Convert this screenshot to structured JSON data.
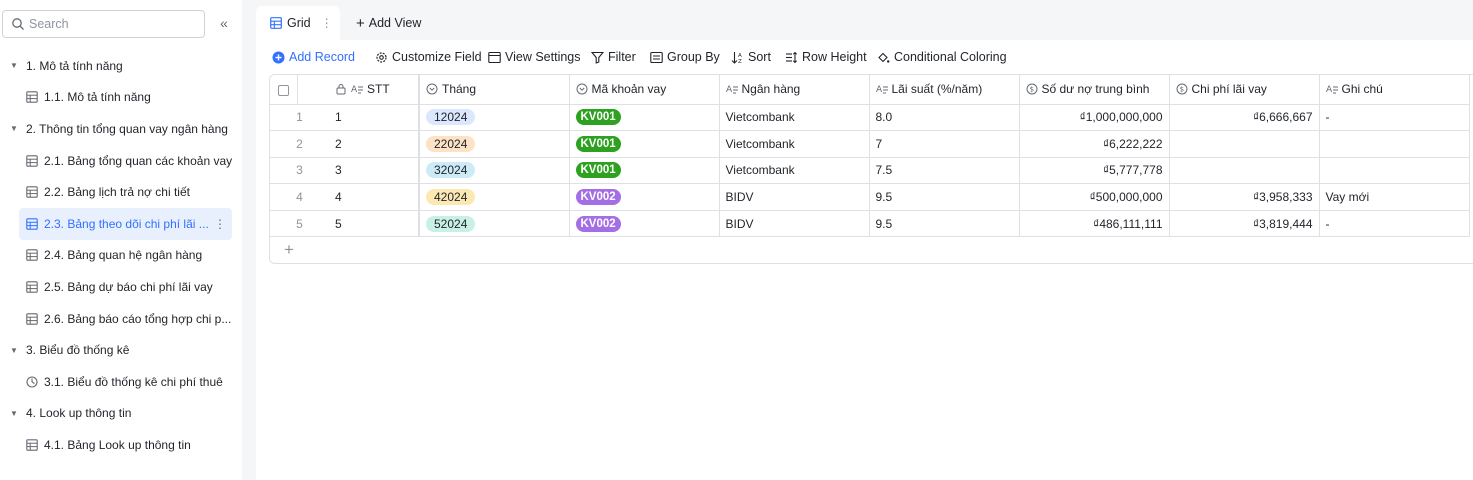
{
  "sidebar": {
    "search_placeholder": "Search",
    "items": [
      {
        "type": "group",
        "label": "1. Mô tả tính năng"
      },
      {
        "type": "leaf",
        "label": "1.1. Mô tả tính năng",
        "icon": "table-icon"
      },
      {
        "type": "group",
        "label": "2. Thông tin tổng quan vay ngân hàng"
      },
      {
        "type": "leaf",
        "label": "2.1. Bảng tổng quan các khoản vay",
        "icon": "table-icon"
      },
      {
        "type": "leaf",
        "label": "2.2. Bảng lịch trả nợ chi tiết",
        "icon": "table-icon"
      },
      {
        "type": "leaf",
        "label": "2.3. Bảng theo dõi chi phí lãi ...",
        "icon": "table-icon",
        "active": true
      },
      {
        "type": "leaf",
        "label": "2.4. Bảng quan hệ ngân hàng",
        "icon": "table-icon"
      },
      {
        "type": "leaf",
        "label": "2.5. Bảng dự báo chi phí lãi vay",
        "icon": "table-icon"
      },
      {
        "type": "leaf",
        "label": "2.6. Bảng báo cáo tổng hợp chi p...",
        "icon": "table-icon"
      },
      {
        "type": "group",
        "label": "3. Biểu đồ thống kê"
      },
      {
        "type": "leaf",
        "label": "3.1. Biểu đồ thống kê chi phí thuê",
        "icon": "dashboard-icon"
      },
      {
        "type": "group",
        "label": "4. Look up thông tin"
      },
      {
        "type": "leaf",
        "label": "4.1. Bảng Look up thông tin",
        "icon": "table-icon"
      }
    ]
  },
  "tabs": {
    "grid_label": "Grid",
    "add_view_label": "Add View"
  },
  "toolbar": {
    "add_record": "Add Record",
    "customize_field": "Customize Field",
    "view_settings": "View Settings",
    "filter": "Filter",
    "group_by": "Group By",
    "sort": "Sort",
    "row_height": "Row Height",
    "conditional_coloring": "Conditional Coloring"
  },
  "table": {
    "columns": [
      "STT",
      "Tháng",
      "Mã khoản vay",
      "Ngân hàng",
      "Lãi suất (%/năm)",
      "Số dư nợ trung bình",
      "Chi phí lãi vay",
      "Ghi chú"
    ],
    "rows": [
      {
        "idx": "1",
        "stt": "1",
        "thang": "12024",
        "thang_color": "#dbe7fd",
        "ma": "KV001",
        "ma_color": "#2ea121",
        "ngan_hang": "Vietcombank",
        "lai_suat": "8.0",
        "so_du": "₫1,000,000,000",
        "chi_phi": "₫6,666,667",
        "ghi_chu": "-"
      },
      {
        "idx": "2",
        "stt": "2",
        "thang": "22024",
        "thang_color": "#fde2c6",
        "ma": "KV001",
        "ma_color": "#2ea121",
        "ngan_hang": "Vietcombank",
        "lai_suat": "7",
        "so_du": "₫6,222,222",
        "chi_phi": "",
        "ghi_chu": ""
      },
      {
        "idx": "3",
        "stt": "3",
        "thang": "32024",
        "thang_color": "#cdebf6",
        "ma": "KV001",
        "ma_color": "#2ea121",
        "ngan_hang": "Vietcombank",
        "lai_suat": "7.5",
        "so_du": "₫5,777,778",
        "chi_phi": "",
        "ghi_chu": ""
      },
      {
        "idx": "4",
        "stt": "4",
        "thang": "42024",
        "thang_color": "#fce8b3",
        "ma": "KV002",
        "ma_color": "#a46ee4",
        "ngan_hang": "BIDV",
        "lai_suat": "9.5",
        "so_du": "₫500,000,000",
        "chi_phi": "₫3,958,333",
        "ghi_chu": "Vay mới"
      },
      {
        "idx": "5",
        "stt": "5",
        "thang": "52024",
        "thang_color": "#c8f0e4",
        "ma": "KV002",
        "ma_color": "#a46ee4",
        "ngan_hang": "BIDV",
        "lai_suat": "9.5",
        "so_du": "₫486,111,111",
        "chi_phi": "₫3,819,444",
        "ghi_chu": "-"
      }
    ]
  },
  "colors": {
    "accent": "#3370ff",
    "kv001": "#2ea121",
    "kv002": "#a46ee4"
  }
}
